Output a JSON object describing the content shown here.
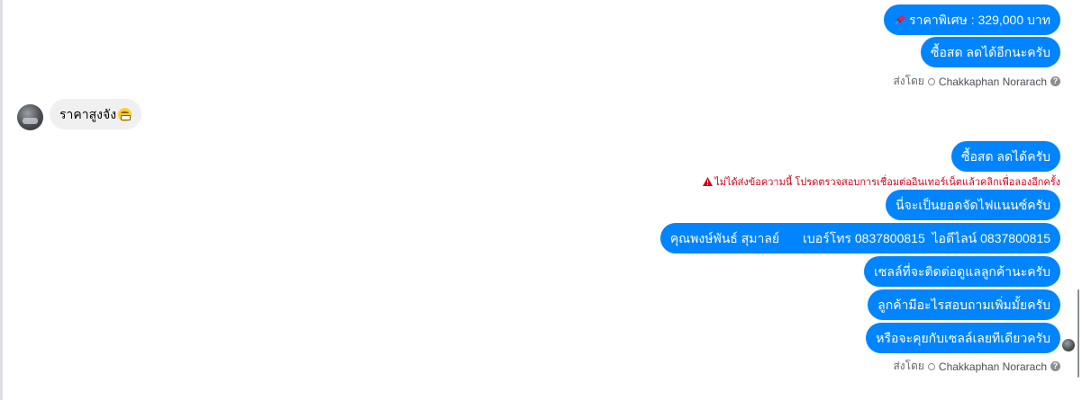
{
  "messages_out_top": {
    "price": "ราคาพิเศษ : 329,000 บาท",
    "buy_cash": "ซื้อสด ลดได้อีกนะครับ"
  },
  "sent_by_1": {
    "prefix": "ส่งโดย",
    "name": "Chakkaphan Norarach",
    "help": "?"
  },
  "incoming": {
    "text": "ราคาสูงจัง"
  },
  "messages_out_bottom": {
    "buy_cash_2": "ซื้อสด ลดได้ครับ",
    "error": "ไม่ได้ส่งข้อความนี้ โปรดตรวจสอบการเชื่อมต่ออินเทอร์เน็ตแล้วคลิกเพื่อลองอีกครั้ง",
    "contact_person": "นี่จะเป็นยอดจัดไฟแนนซ์ครับ",
    "contact_name": "คุณพงษ์พันธ์ สุมาลย์",
    "contact_phone": "เบอร์โทร 0837800815",
    "contact_line": "ไอดีไลน์ 0837800815",
    "sales_followup": "เซลล์ที่จะติดต่อดูแลลูกค้านะครับ",
    "more_questions": "ลูกค้ามีอะไรสอบถามเพิ่มมั้ยครับ",
    "talk_to_sales": "หรือจะคุยกับเซลล์เลยทีเดียวครับ"
  },
  "sent_by_2": {
    "prefix": "ส่งโดย",
    "name": "Chakkaphan Norarach",
    "help": "?"
  },
  "colors": {
    "outgoing_bubble": "#0084ff",
    "incoming_bubble": "#f0f0f0",
    "error_text": "#d0021b"
  }
}
